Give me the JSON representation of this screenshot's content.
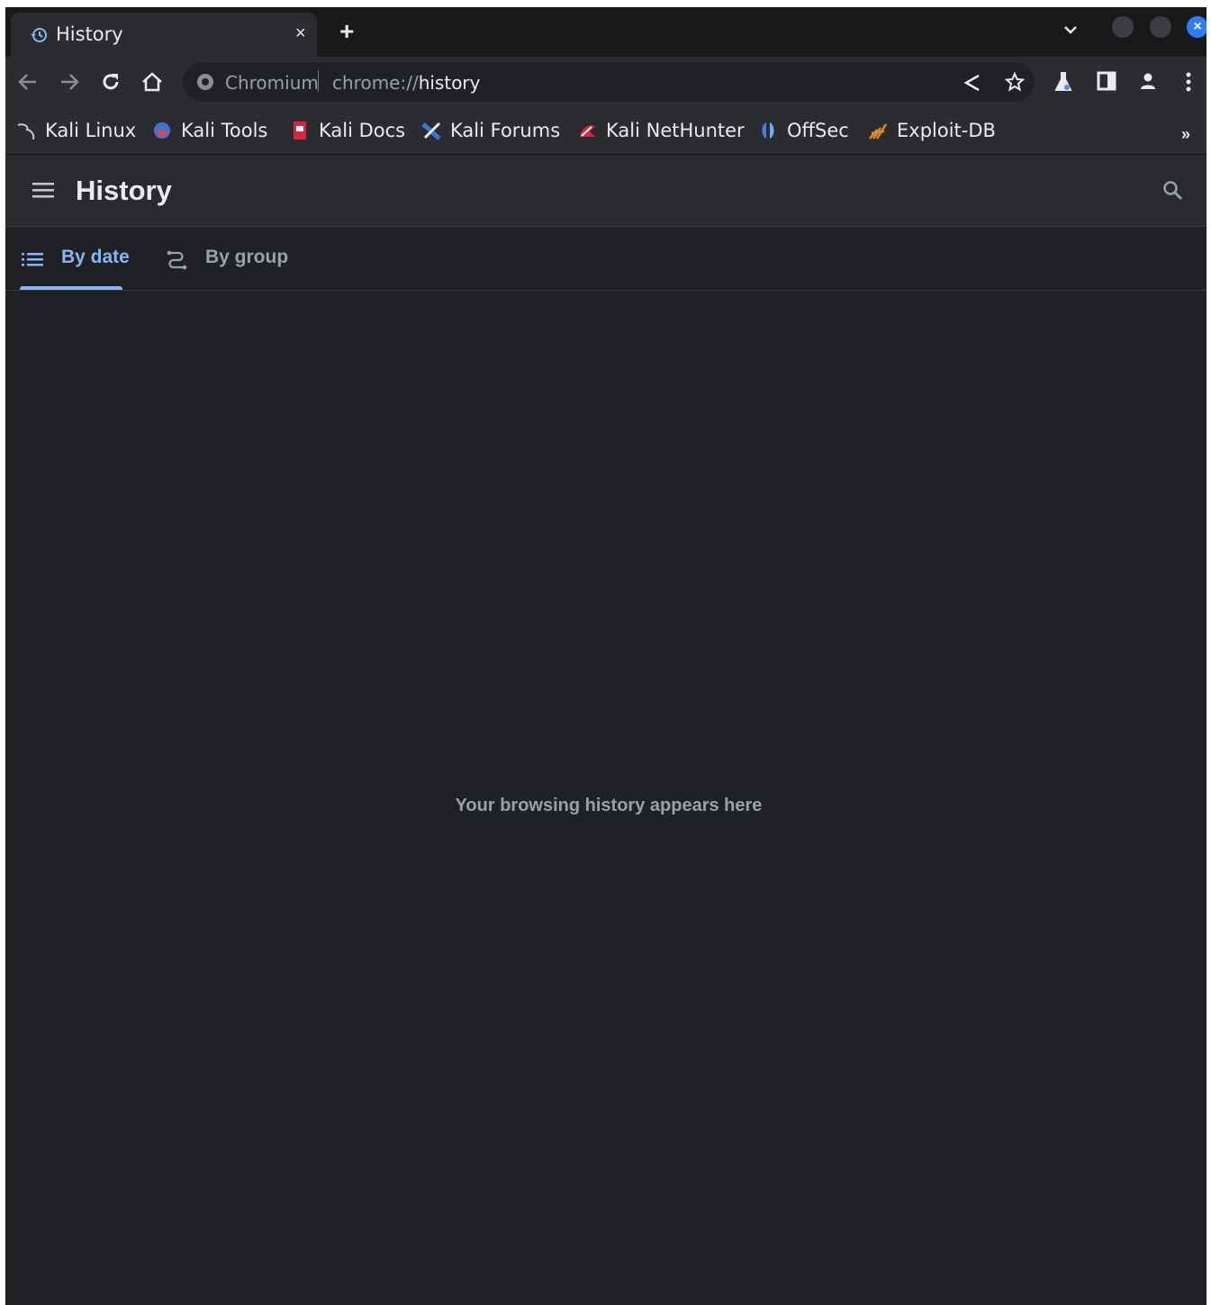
{
  "browser": {
    "tab": {
      "title": "History",
      "close_glyph": "×",
      "favicon": "history-icon"
    },
    "new_tab_glyph": "+",
    "omnibox": {
      "site_label": "Chromium",
      "url_scheme": "chrome://",
      "url_host": "history"
    },
    "bookmarks": [
      {
        "label": "Kali Linux",
        "icon": "kali-dragon-icon"
      },
      {
        "label": "Kali Tools",
        "icon": "kali-tools-icon"
      },
      {
        "label": "Kali Docs",
        "icon": "kali-docs-icon"
      },
      {
        "label": "Kali Forums",
        "icon": "kali-forums-icon"
      },
      {
        "label": "Kali NetHunter",
        "icon": "kali-nethunter-icon"
      },
      {
        "label": "OffSec",
        "icon": "offsec-icon"
      },
      {
        "label": "Exploit-DB",
        "icon": "exploit-db-icon"
      }
    ],
    "bookmarks_overflow_glyph": "»"
  },
  "page": {
    "title": "History",
    "tabs": [
      {
        "label": "By date",
        "icon": "list-icon",
        "selected": true
      },
      {
        "label": "By group",
        "icon": "journeys-icon",
        "selected": false
      }
    ],
    "empty_message": "Your browsing history appears here"
  },
  "colors": {
    "accent": "#8ab4f8",
    "window_close": "#2f7df5",
    "page_background": "#202124"
  }
}
